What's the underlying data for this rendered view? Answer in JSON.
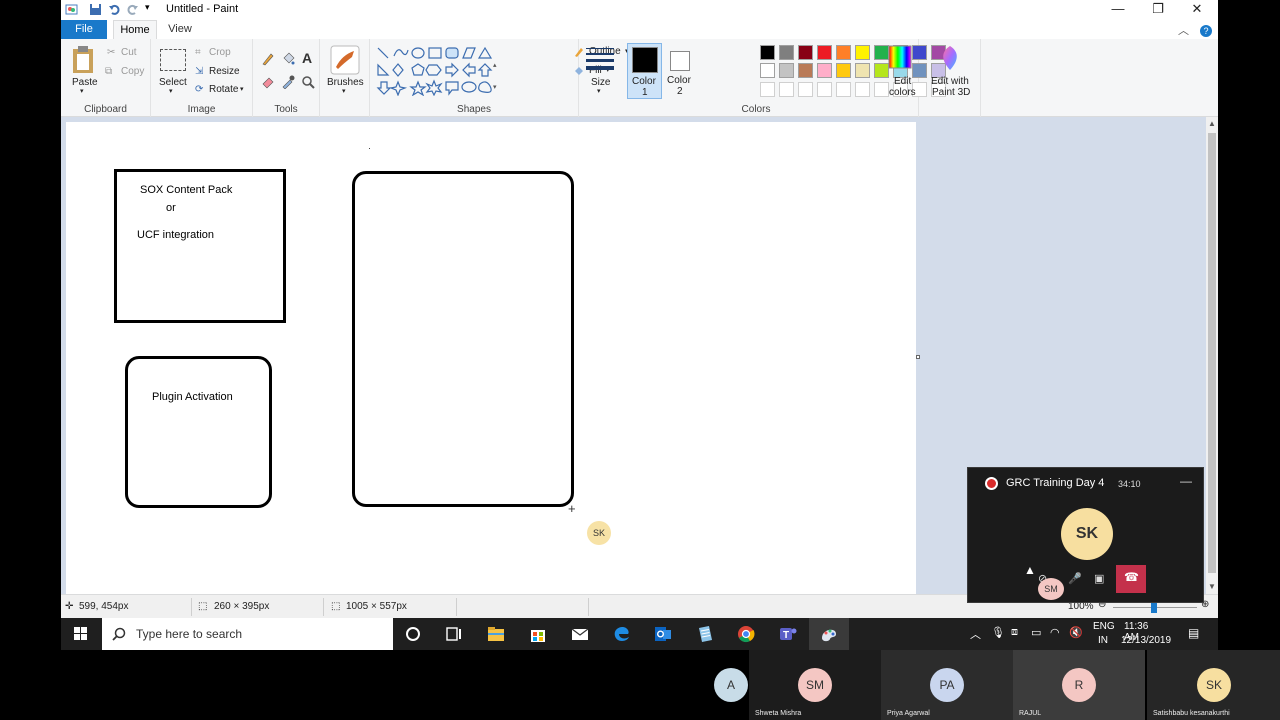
{
  "window": {
    "title": "Untitled - Paint"
  },
  "tabs": {
    "file": "File",
    "home": "Home",
    "view": "View"
  },
  "ribbon": {
    "clipboard": {
      "paste": "Paste",
      "cut": "Cut",
      "copy": "Copy",
      "label": "Clipboard"
    },
    "image": {
      "select": "Select",
      "crop": "Crop",
      "resize": "Resize",
      "rotate": "Rotate",
      "label": "Image"
    },
    "tools": {
      "label": "Tools"
    },
    "brushes": {
      "label": "Brushes"
    },
    "shapes": {
      "outline": "Outline",
      "fill": "Fill",
      "label": "Shapes"
    },
    "size": {
      "label": "Size"
    },
    "color1": {
      "label": "Color",
      "num": "1"
    },
    "color2": {
      "label": "Color",
      "num": "2"
    },
    "colors": {
      "label": "Colors",
      "row1": [
        "#000000",
        "#7f7f7f",
        "#880015",
        "#ed1c24",
        "#ff7f27",
        "#fff200",
        "#22b14c",
        "#00a2e8",
        "#3f48cc",
        "#a349a4"
      ],
      "row2": [
        "#ffffff",
        "#c3c3c3",
        "#b97a57",
        "#ffaec9",
        "#ffc90e",
        "#efe4b0",
        "#b5e61d",
        "#99d9ea",
        "#7092be",
        "#c8bfe7"
      ]
    },
    "edit_colors": {
      "line1": "Edit",
      "line2": "colors"
    },
    "paint3d": {
      "line1": "Edit with",
      "line2": "Paint 3D"
    }
  },
  "canvas": {
    "box1_line1": "SOX Content Pack",
    "box1_line2": "or",
    "box1_line3": "UCF integration",
    "box2_text": "Plugin Activation",
    "cursor_badge": "SK"
  },
  "status": {
    "position": "599, 454px",
    "selection": "260 × 395px",
    "canvas_size": "1005 × 557px",
    "zoom": "100%"
  },
  "taskbar": {
    "search_placeholder": "Type here to search",
    "lang1": "ENG",
    "lang2": "IN",
    "time": "11:36 AM",
    "date": "12/13/2019"
  },
  "teams": {
    "title": "GRC Training Day 4",
    "duration": "34:10",
    "presenter_initials": "SK",
    "small_avatar": "SM"
  },
  "participants": [
    {
      "initials": "A",
      "name": "",
      "color": "#c8dce8"
    },
    {
      "initials": "SM",
      "name": "Shweta Mishra",
      "color": "#f4c7c3"
    },
    {
      "initials": "PA",
      "name": "Priya Agarwal",
      "color": "#c9d6ee"
    },
    {
      "initials": "R",
      "name": "RAJUL",
      "color": "#f4c7c3"
    },
    {
      "initials": "SK",
      "name": "Satishbabu kesanakurthi",
      "color": "#f7dfa0"
    }
  ]
}
